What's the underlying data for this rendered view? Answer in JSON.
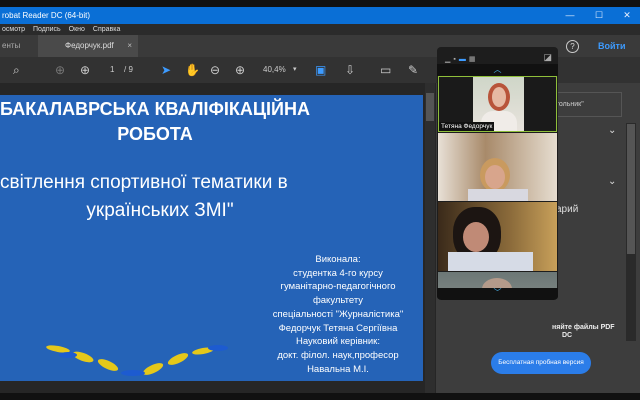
{
  "window": {
    "title": "robat Reader DC (64-bit)",
    "min": "—",
    "max": "☐",
    "close": "✕"
  },
  "menu": [
    "осмотр",
    "Подпись",
    "Окно",
    "Справка"
  ],
  "tabs": {
    "left": "енты",
    "active": "Федорчук.pdf",
    "close": "×",
    "help": "?",
    "login": "Войти"
  },
  "toolbar": {
    "page_current": "1",
    "page_total": "/ 9",
    "zoom": "40,4%"
  },
  "slide": {
    "heading1": "БАКАЛАВРСЬКА КВАЛІФІКАЦІЙНА",
    "heading2": "РОБОТА",
    "topic1": "світлення спортивної тематики в",
    "topic2": "українських ЗМІ\"",
    "author_lines": [
      "Виконала:",
      "студентка 4-го курсу",
      "гуманітарно-педагогічного",
      "факультету",
      "спеціальності \"Журналістика\"",
      "Федорчук Тетяна Сергіївна",
      "Науковий керівник:",
      "докт. філол. наук,професор",
      "Навальна М.І."
    ]
  },
  "right_panel": {
    "field_text": "угольник\"",
    "item_text": "арий",
    "promo": "няйте файлы PDF",
    "promo2": "DC",
    "trial_button": "Бесплатная пробная версия"
  },
  "video": {
    "participant_name": "Тетяна Федорчук"
  }
}
